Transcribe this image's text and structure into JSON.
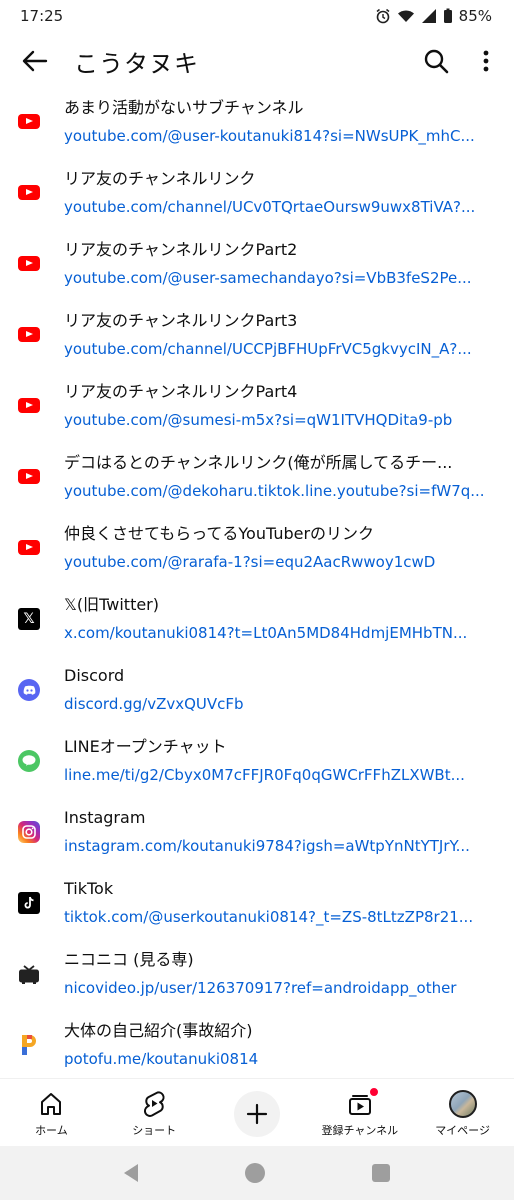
{
  "status": {
    "time": "17:25",
    "battery": "85%"
  },
  "header": {
    "title": "こうタヌキ"
  },
  "links": [
    {
      "icon": "youtube-icon",
      "title": "あまり活動がないサブチャンネル",
      "url": "youtube.com/@user-koutanuki814?si=NWsUPK_mhC..."
    },
    {
      "icon": "youtube-icon",
      "title": "リア友のチャンネルリンク",
      "url": "youtube.com/channel/UCv0TQrtaeOursw9uwx8TiVA?..."
    },
    {
      "icon": "youtube-icon",
      "title": "リア友のチャンネルリンクPart2",
      "url": "youtube.com/@user-samechandayo?si=VbB3feS2Pe..."
    },
    {
      "icon": "youtube-icon",
      "title": "リア友のチャンネルリンクPart3",
      "url": "youtube.com/channel/UCCPjBFHUpFrVC5gkvycIN_A?..."
    },
    {
      "icon": "youtube-icon",
      "title": "リア友のチャンネルリンクPart4",
      "url": "youtube.com/@sumesi-m5x?si=qW1ITVHQDita9-pb"
    },
    {
      "icon": "youtube-icon",
      "title": "デコはるとのチャンネルリンク(俺が所属してるチー...",
      "url": "youtube.com/@dekoharu.tiktok.line.youtube?si=fW7q..."
    },
    {
      "icon": "youtube-icon",
      "title": "仲良くさせてもらってるYouTuberのリンク",
      "url": "youtube.com/@rarafa-1?si=equ2AacRwwoy1cwD"
    },
    {
      "icon": "x-icon",
      "title": "𝕏(旧Twitter)",
      "url": "x.com/koutanuki0814?t=Lt0An5MD84HdmjEMHbTN..."
    },
    {
      "icon": "discord-icon",
      "title": "Discord",
      "url": "discord.gg/vZvxQUVcFb"
    },
    {
      "icon": "line-icon",
      "title": "LINEオープンチャット",
      "url": "line.me/ti/g2/Cbyx0M7cFFJR0Fq0qGWCrFFhZLXWBt..."
    },
    {
      "icon": "instagram-icon",
      "title": "Instagram",
      "url": "instagram.com/koutanuki9784?igsh=aWtpYnNtYTJrY..."
    },
    {
      "icon": "tiktok-icon",
      "title": "TikTok",
      "url": "tiktok.com/@userkoutanuki0814?_t=ZS-8tLtzZP8r21..."
    },
    {
      "icon": "niconico-icon",
      "title": "ニコニコ (見る専)",
      "url": "nicovideo.jp/user/126370917?ref=androidapp_other"
    },
    {
      "icon": "potofu-icon",
      "title": "大体の自己紹介(事故紹介)",
      "url": "potofu.me/koutanuki0814"
    }
  ],
  "bottom_nav": {
    "home": "ホーム",
    "shorts": "ショート",
    "subscriptions": "登録チャンネル",
    "mypage": "マイページ"
  },
  "colors": {
    "link": "#065fd4",
    "youtube_red": "#ff0000"
  }
}
